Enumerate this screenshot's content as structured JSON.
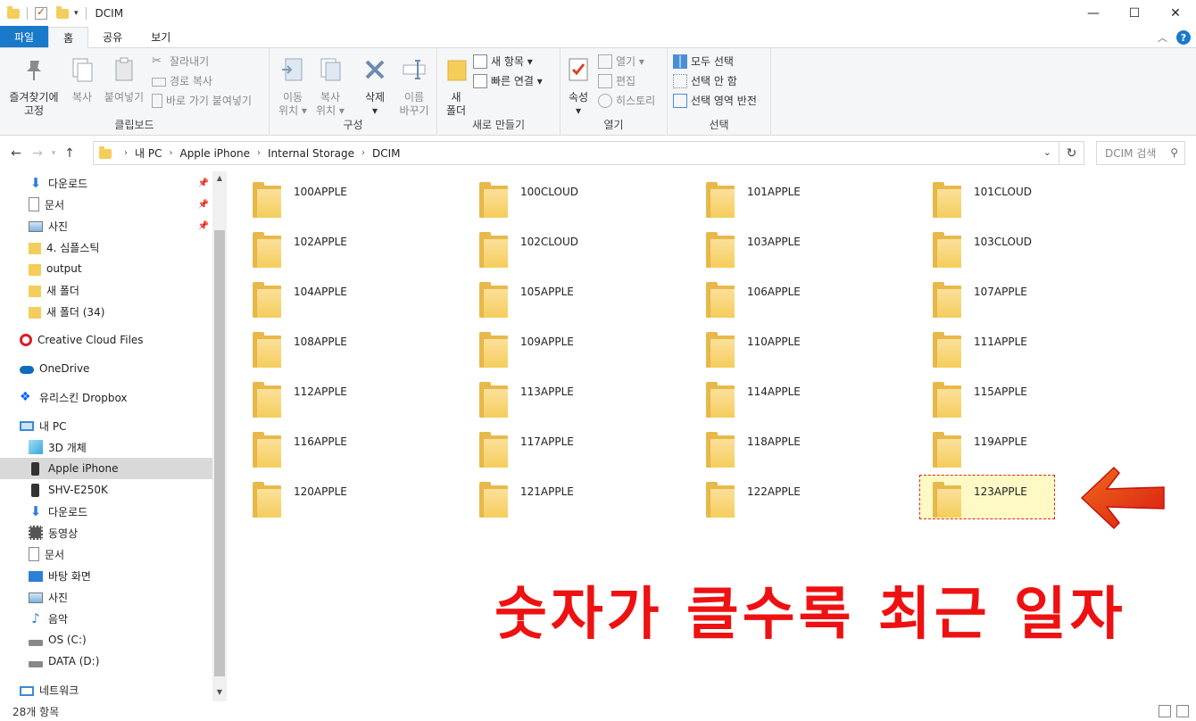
{
  "window": {
    "title": "DCIM",
    "minimize": "—",
    "maximize": "☐",
    "close": "✕"
  },
  "ribbon_tabs": [
    "파일",
    "홈",
    "공유",
    "보기"
  ],
  "ribbon": {
    "clipboard": {
      "label": "클립보드",
      "pin": [
        "즐겨찾기에",
        "고정"
      ],
      "copy": "복사",
      "paste": "붙여넣기",
      "cut": "잘라내기",
      "copy_path": "경로 복사",
      "paste_shortcut": "바로 가기 붙여넣기"
    },
    "organize": {
      "label": "구성",
      "move": [
        "이동",
        "위치 ▾"
      ],
      "copyto": [
        "복사",
        "위치 ▾"
      ],
      "delete": [
        "삭제",
        "▾"
      ],
      "rename": [
        "이름",
        "바꾸기"
      ]
    },
    "new": {
      "label": "새로 만들기",
      "new_folder": [
        "새",
        "폴더"
      ],
      "new_item": "새 항목 ▾",
      "easy_access": "빠른 연결 ▾"
    },
    "open": {
      "label": "열기",
      "properties": [
        "속성",
        "▾"
      ],
      "open": "열기 ▾",
      "edit": "편집",
      "history": "히스토리"
    },
    "select": {
      "label": "선택",
      "select_all": "모두 선택",
      "select_none": "선택 안 함",
      "invert": "선택 영역 반전"
    }
  },
  "address": {
    "crumbs": [
      "내 PC",
      "Apple iPhone",
      "Internal Storage",
      "DCIM"
    ],
    "search_placeholder": "DCIM 검색"
  },
  "nav": {
    "quick_access": [
      {
        "label": "다운로드",
        "icon": "download-icon",
        "pinned": true
      },
      {
        "label": "문서",
        "icon": "document-icon",
        "pinned": true
      },
      {
        "label": "사진",
        "icon": "picture-icon",
        "pinned": true
      },
      {
        "label": "4. 심플스틱",
        "icon": "folder-icon",
        "pinned": false
      },
      {
        "label": "output",
        "icon": "folder-icon",
        "pinned": false
      },
      {
        "label": "새 폴더",
        "icon": "folder-icon",
        "pinned": false
      },
      {
        "label": "새 폴더 (34)",
        "icon": "folder-icon",
        "pinned": false
      }
    ],
    "creative_cloud": "Creative Cloud Files",
    "onedrive": "OneDrive",
    "dropbox": "유리스킨 Dropbox",
    "this_pc": "내 PC",
    "pc_items": [
      {
        "label": "3D 개체",
        "icon": "cube-icon"
      },
      {
        "label": "Apple iPhone",
        "icon": "phone-icon",
        "selected": true
      },
      {
        "label": "SHV-E250K",
        "icon": "phone-icon"
      },
      {
        "label": "다운로드",
        "icon": "download-icon"
      },
      {
        "label": "동영상",
        "icon": "video-icon"
      },
      {
        "label": "문서",
        "icon": "document-icon"
      },
      {
        "label": "바탕 화면",
        "icon": "desktop-icon"
      },
      {
        "label": "사진",
        "icon": "picture-icon"
      },
      {
        "label": "음악",
        "icon": "music-icon"
      },
      {
        "label": "OS (C:)",
        "icon": "drive-icon"
      },
      {
        "label": "DATA (D:)",
        "icon": "drive-icon"
      }
    ],
    "network": "네트워크"
  },
  "folders": [
    "100APPLE",
    "100CLOUD",
    "101APPLE",
    "101CLOUD",
    "102APPLE",
    "102CLOUD",
    "103APPLE",
    "103CLOUD",
    "104APPLE",
    "105APPLE",
    "106APPLE",
    "107APPLE",
    "108APPLE",
    "109APPLE",
    "110APPLE",
    "111APPLE",
    "112APPLE",
    "113APPLE",
    "114APPLE",
    "115APPLE",
    "116APPLE",
    "117APPLE",
    "118APPLE",
    "119APPLE",
    "120APPLE",
    "121APPLE",
    "122APPLE",
    "123APPLE"
  ],
  "highlighted_folder": "123APPLE",
  "annotation": "숫자가 클수록 최근 일자",
  "status": "28개 항목",
  "colors": {
    "accent": "#1979ca",
    "annotation": "#ee1111",
    "folder": "#f5cd5b"
  }
}
